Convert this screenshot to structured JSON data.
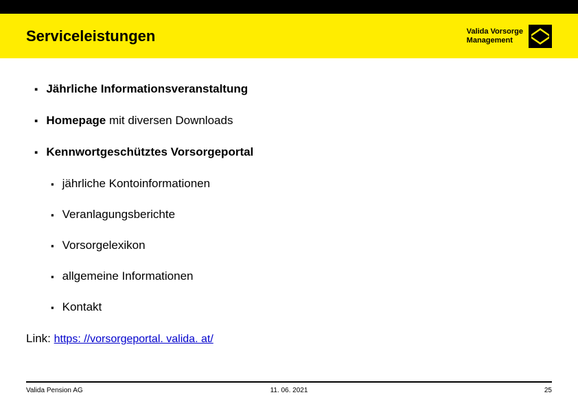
{
  "header": {
    "title": "Serviceleistungen",
    "brand_line1": "Valida Vorsorge",
    "brand_line2": "Management"
  },
  "bullets": {
    "b1_bold": "Jährliche Informationsveranstaltung",
    "b2_bold": "Homepage",
    "b2_rest": " mit diversen Downloads",
    "b3_bold": "Kennwortgeschütztes Vorsorgeportal",
    "sub1": "jährliche Kontoinformationen",
    "sub2": "Veranlagungsberichte",
    "sub3": "Vorsorgelexikon",
    "sub4": "allgemeine Informationen",
    "sub5": "Kontakt"
  },
  "link": {
    "label": "Link: ",
    "url_text": "https: //vorsorgeportal. valida. at/",
    "url_href": "https://vorsorgeportal.valida.at/"
  },
  "footer": {
    "left": "Valida Pension AG",
    "center": "11. 06. 2021",
    "right": "25"
  }
}
